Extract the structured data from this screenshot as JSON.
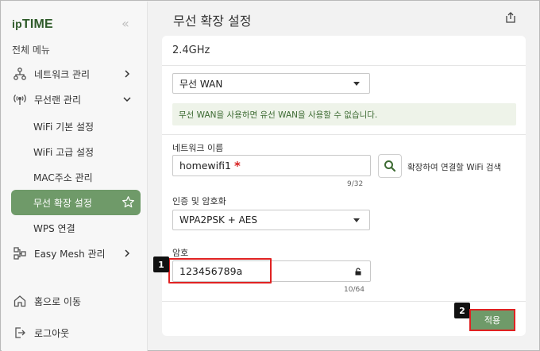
{
  "sidebar": {
    "logo_prefix": "ip",
    "logo_main": "TIME",
    "collapse_glyph": "«",
    "menu_title": "전체 메뉴",
    "items": [
      {
        "label": "네트워크 관리",
        "icon": "network-icon"
      },
      {
        "label": "무선랜 관리",
        "icon": "wifi-icon"
      },
      {
        "label": "WiFi 기본 설정"
      },
      {
        "label": "WiFi 고급 설정"
      },
      {
        "label": "MAC주소 관리"
      },
      {
        "label": "무선 확장 설정",
        "active": true
      },
      {
        "label": "WPS 연결"
      },
      {
        "label": "Easy Mesh 관리",
        "icon": "mesh-icon"
      },
      {
        "label": "홈으로 이동",
        "icon": "home-icon"
      },
      {
        "label": "로그아웃",
        "icon": "logout-icon"
      }
    ]
  },
  "header": {
    "title": "무선 확장 설정"
  },
  "card": {
    "band": "2.4GHz",
    "wan_select": "무선 WAN",
    "notice": "무선 WAN을 사용하면 유선 WAN을 사용할 수 없습니다.",
    "ssid": {
      "label": "네트워크 이름",
      "value": "homewifi1",
      "required_mark": "*",
      "counter": "9/32",
      "search_label": "확장하여 연결할 WiFi 검색"
    },
    "auth": {
      "label": "인증 및 암호화",
      "value": "WPA2PSK + AES"
    },
    "password": {
      "label": "암호",
      "value": "123456789a",
      "counter": "10/64"
    },
    "apply_label": "적용"
  },
  "steps": [
    "1",
    "2"
  ],
  "colors": {
    "accent": "#6f9a69",
    "highlight": "#e02222",
    "notice_bg": "#eef3e9",
    "logo": "#2f5b2a"
  }
}
